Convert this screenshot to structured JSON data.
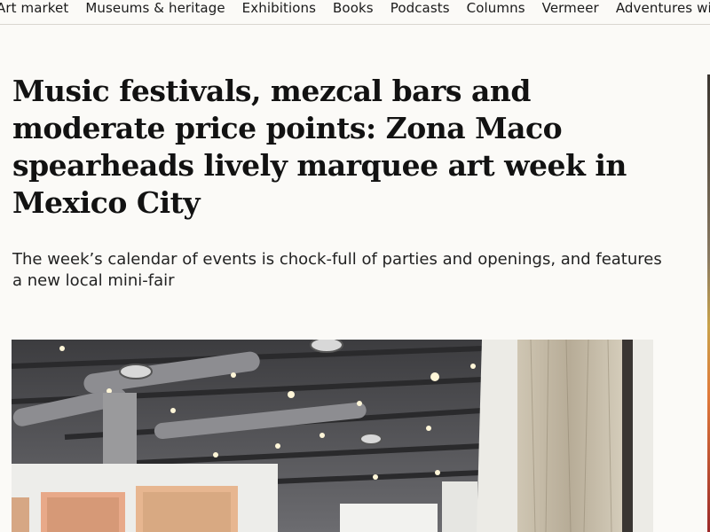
{
  "nav": {
    "items": [
      "Art market",
      "Museums & heritage",
      "Exhibitions",
      "Books",
      "Podcasts",
      "Columns",
      "Vermeer",
      "Adventures with Va"
    ]
  },
  "article": {
    "headline": "Music festivals, mezcal bars and moderate price points: Zona Maco spearheads lively marquee art week in Mexico City",
    "standfirst": "The week’s calendar of events is chock-full of parties and openings, and features a new local mini-fair"
  },
  "colors": {
    "background": "#fbfaf7",
    "text": "#1a1a1a",
    "divider": "#d9d6cf"
  }
}
